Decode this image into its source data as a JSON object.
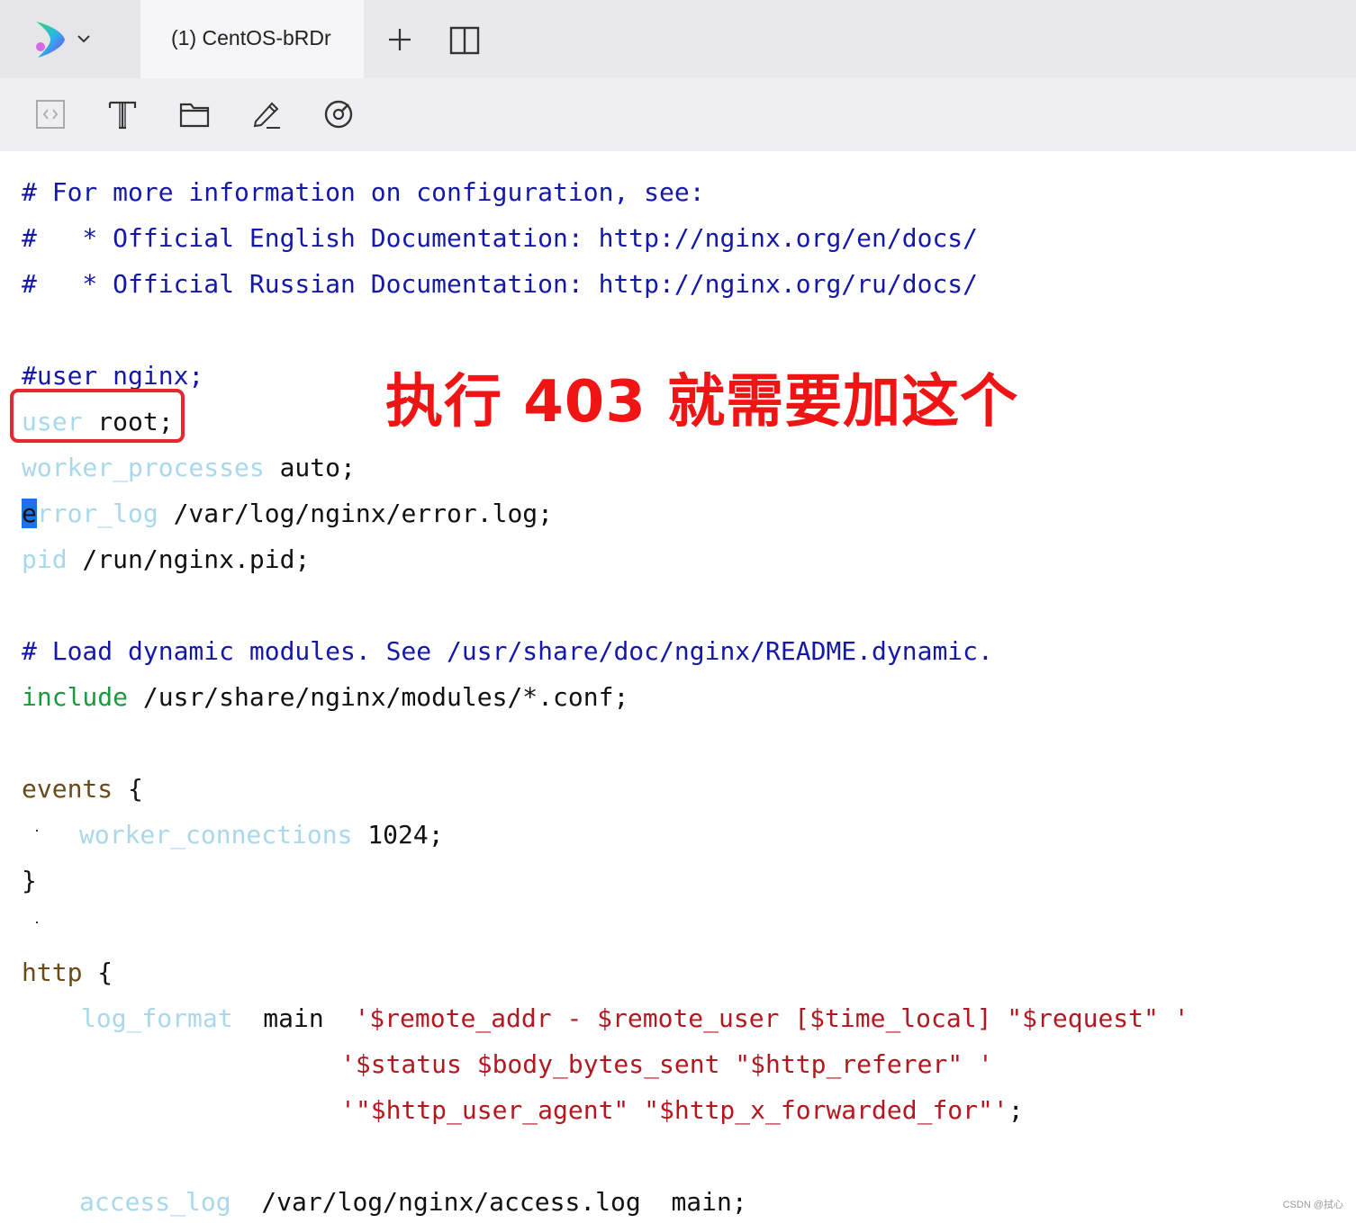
{
  "tab": {
    "title": "(1) CentOS-bRDr"
  },
  "toolbar": {
    "icons": [
      "code-icon",
      "text-icon",
      "folder-icon",
      "edit-icon",
      "compass-icon"
    ]
  },
  "editor": {
    "l1": "# For more information on configuration, see:",
    "l2": "#   * Official English Documentation: http://nginx.org/en/docs/",
    "l3": "#   * Official Russian Documentation: http://nginx.org/ru/docs/",
    "l4": "#user nginx;",
    "l5a": "user",
    "l5b": " root;",
    "l6a": "worker_processes",
    "l6b": " auto;",
    "l7cur": "e",
    "l7a": "rror_log",
    "l7b": " /var/log/nginx/error.log;",
    "l8a": "pid",
    "l8b": " /run/nginx.pid;",
    "l9": "# Load dynamic modules. See /usr/share/doc/nginx/README.dynamic.",
    "l10a": "include",
    "l10b": " /usr/share/nginx/modules/*.conf;",
    "l11a": "events",
    "l11b": " {",
    "l12a": "worker_connections",
    "l12b": " 1024;",
    "l13": "}",
    "l14a": "http",
    "l14b": " {",
    "l15a": "log_format",
    "l15b": "  main  ",
    "l15c": "'$remote_addr - $remote_user [$time_local] \"$request\" '",
    "l16": "'$status $body_bytes_sent \"$http_referer\" '",
    "l17a": "'\"$http_user_agent\" \"$http_x_forwarded_for\"'",
    "l17b": ";",
    "l18a": "access_log",
    "l18b": "  /var/log/nginx/access.log  main;"
  },
  "annotation": "执行 403 就需要加这个",
  "watermark": "CSDN @拭心",
  "colors": {
    "comment": "#1418a8",
    "directive": "#a8d8ea",
    "keyword": "#1a9a3e",
    "block": "#6b4a1a",
    "string": "#b5171f",
    "highlight": "#e8262d",
    "annotation": "#f01414"
  }
}
